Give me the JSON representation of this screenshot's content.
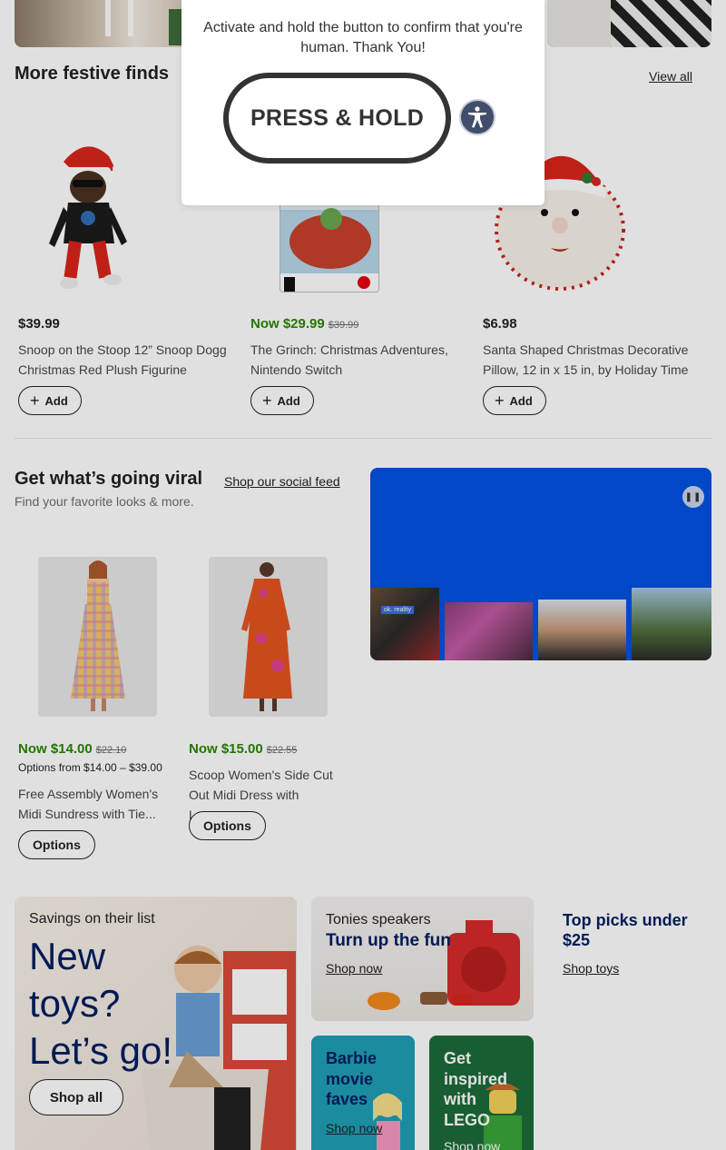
{
  "modal": {
    "message": "Activate and hold the button to confirm that you're human. Thank You!",
    "button_label": "PRESS & HOLD",
    "accessibility_icon": "accessibility-icon"
  },
  "festive": {
    "title": "More festive finds",
    "view_all": "View all",
    "products": [
      {
        "price": "$39.99",
        "was": "",
        "title": "Snoop on the Stoop 12” Snoop Dogg Christmas Red Plush Figurine",
        "button": "Add"
      },
      {
        "price": "Now $29.99",
        "was": "$39.99",
        "title": "The Grinch: Christmas Adventures, Nintendo Switch",
        "button": "Add"
      },
      {
        "price": "$6.98",
        "was": "",
        "title": "Santa Shaped Christmas Decorative Pillow, 12 in x 15 in, by Holiday Time",
        "button": "Add"
      }
    ]
  },
  "viral": {
    "title": "Get what’s going viral",
    "link": "Shop our social feed",
    "subtitle": "Find your favorite looks & more.",
    "video_badge": "ok. reality",
    "pause_icon": "pause-icon",
    "products": [
      {
        "price": "Now $14.00",
        "was": "$22.10",
        "options_range": "Options from $14.00 – $39.00",
        "title": "Free Assembly Women's Midi Sundress with Tie...",
        "button": "Options"
      },
      {
        "price": "Now $15.00",
        "was": "$22.55",
        "options_range": "",
        "title": "Scoop Women's Side Cut Out Midi Dress with Lon...",
        "button": "Options"
      }
    ]
  },
  "tiles": {
    "toys": {
      "eyebrow": "Savings on their list",
      "headline_1": "New",
      "headline_2": "toys?",
      "headline_3": "Let’s go!",
      "button": "Shop all"
    },
    "tonies": {
      "eyebrow": "Tonies speakers",
      "headline": "Turn up the fun",
      "link": "Shop now"
    },
    "under25": {
      "headline_1": "Top picks under",
      "headline_2": "$25",
      "link": "Shop toys"
    },
    "barbie": {
      "headline_1": "Barbie",
      "headline_2": "movie",
      "headline_3": "faves",
      "link": "Shop now"
    },
    "lego": {
      "headline_1": "Get",
      "headline_2": "inspired",
      "headline_3": "with",
      "headline_4": "LEGO",
      "link": "Shop now"
    }
  },
  "colors": {
    "price_now": "#2a8703",
    "brand_blue": "#0053e2",
    "navy": "#001e60"
  }
}
